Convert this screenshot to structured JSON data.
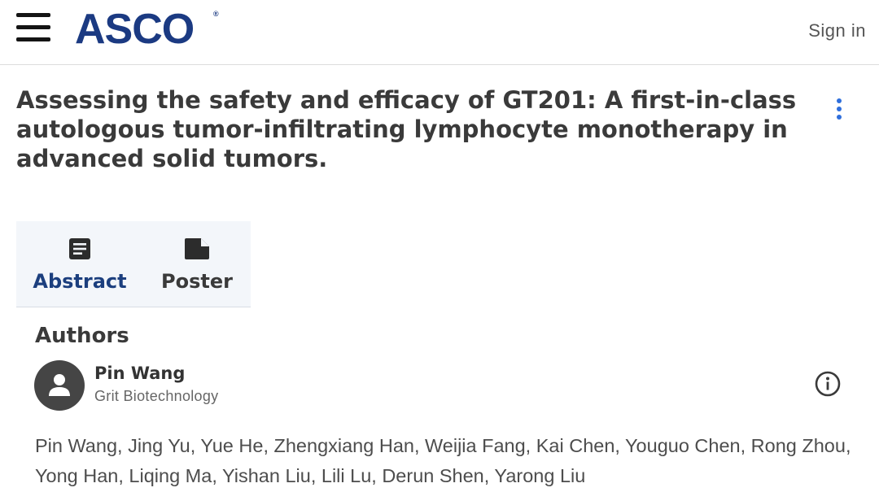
{
  "header": {
    "logo_text": "ASCO",
    "logo_mark": "®",
    "signin_label": "Sign in",
    "menu_icon": "hamburger-menu-icon",
    "brand_color": "#1b3a82"
  },
  "article": {
    "title": "Assessing the safety and efficacy of GT201: A first-in-class autologous tumor-infiltrating lymphocyte monotherapy in advanced solid tumors.",
    "more_icon": "more-vertical-icon",
    "accent_color": "#2f6fdc"
  },
  "tabs": [
    {
      "label": "Abstract",
      "icon": "document-icon",
      "active": true
    },
    {
      "label": "Poster",
      "icon": "poster-icon",
      "active": false
    }
  ],
  "authors": {
    "heading": "Authors",
    "primary": {
      "name": "Pin Wang",
      "affiliation": "Grit Biotechnology",
      "avatar_icon": "person-icon",
      "info_icon": "info-icon"
    },
    "list": "Pin Wang, Jing Yu, Yue He, Zhengxiang Han, Weijia Fang, Kai Chen, Youguo Chen, Rong Zhou, Yong Han, Liqing Ma, Yishan Liu, Lili Lu, Derun Shen, Yarong Liu"
  }
}
